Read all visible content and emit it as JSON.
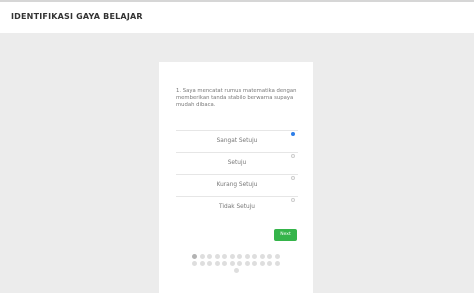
{
  "header": {
    "title": "IDENTIFIKASI GAYA BELAJAR"
  },
  "question": {
    "text": "1. Saya mencatat rumus matematika dengan memberikan tanda stabilo berwarna supaya mudah dibaca."
  },
  "options": [
    {
      "label": "Sangat Setuju",
      "selected": true
    },
    {
      "label": "Setuju",
      "selected": false
    },
    {
      "label": "Kurang Setuju",
      "selected": false
    },
    {
      "label": "Tidak Setuju",
      "selected": false
    }
  ],
  "next_button": {
    "label": "Next"
  },
  "pagination": {
    "total": 25,
    "current": 1
  },
  "colors": {
    "accent": "#35b44a",
    "radio_selected": "#2f7fe8"
  }
}
